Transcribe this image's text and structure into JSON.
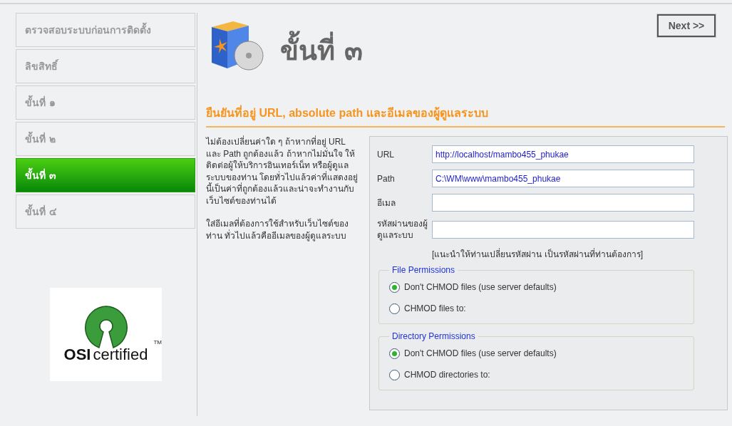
{
  "sidebar": {
    "steps": [
      {
        "label": "ตรวจสอบระบบก่อนการติดตั้ง",
        "selected": false
      },
      {
        "label": "ลิขสิทธิ์",
        "selected": false
      },
      {
        "label": "ขั้นที่ ๑",
        "selected": false
      },
      {
        "label": "ขั้นที่ ๒",
        "selected": false
      },
      {
        "label": "ขั้นที่ ๓",
        "selected": true
      },
      {
        "label": "ขั้นที่ ๔",
        "selected": false
      }
    ]
  },
  "logo": {
    "trademark": "TM",
    "name": "OSI",
    "tagline": "certified"
  },
  "header": {
    "title": "ขั้นที่ ๓",
    "next_button": "Next >>"
  },
  "section_title": "ยืนยันที่อยู่ URL, absolute path และอีเมลของผู้ดูแลระบบ",
  "description": [
    "ไม่ต้องเปลี่ยนค่าใด ๆ ถ้าหากที่อยู่ URL และ Path ถูกต้องแล้ว ถ้าหากไม่มั่นใจ ให้ติดต่อผู้ให้บริการอินเทอร์เน็ท หรือผู้ดูแลระบบของท่าน โดยทั่วไปแล้วค่าที่แสดงอยู่นี้เป็นค่าที่ถูกต้องแล้วและน่าจะทำงานกับเว็บไซต์ของท่านได้",
    "ใส่อีเมลที่ต้องการใช้สำหรับเว็บไซต์ของท่าน ทั่วไปแล้วคืออีเมลของผู้ดูแลระบบ"
  ],
  "form": {
    "fields": [
      {
        "label": "URL",
        "value": "http://localhost/mambo455_phukae"
      },
      {
        "label": "Path",
        "value": "C:\\WM\\www\\mambo455_phukae"
      },
      {
        "label": "อีเมล"
      },
      {
        "label": "รหัสผ่านของผู้ดูแลระบบ"
      }
    ],
    "hint": "[แนะนำให้ท่านเปลี่ยนรหัสผ่าน เป็นรหัสผ่านที่ท่านต้องการ]",
    "permission_groups": [
      {
        "legend": "File Permissions",
        "options": [
          {
            "label": "Don't CHMOD files (use server defaults)",
            "selected": true
          },
          {
            "label": "CHMOD files to:",
            "selected": false
          }
        ]
      },
      {
        "legend": "Directory Permissions",
        "options": [
          {
            "label": "Don't CHMOD files (use server defaults)",
            "selected": true
          },
          {
            "label": "CHMOD directories to:",
            "selected": false
          }
        ]
      }
    ]
  }
}
